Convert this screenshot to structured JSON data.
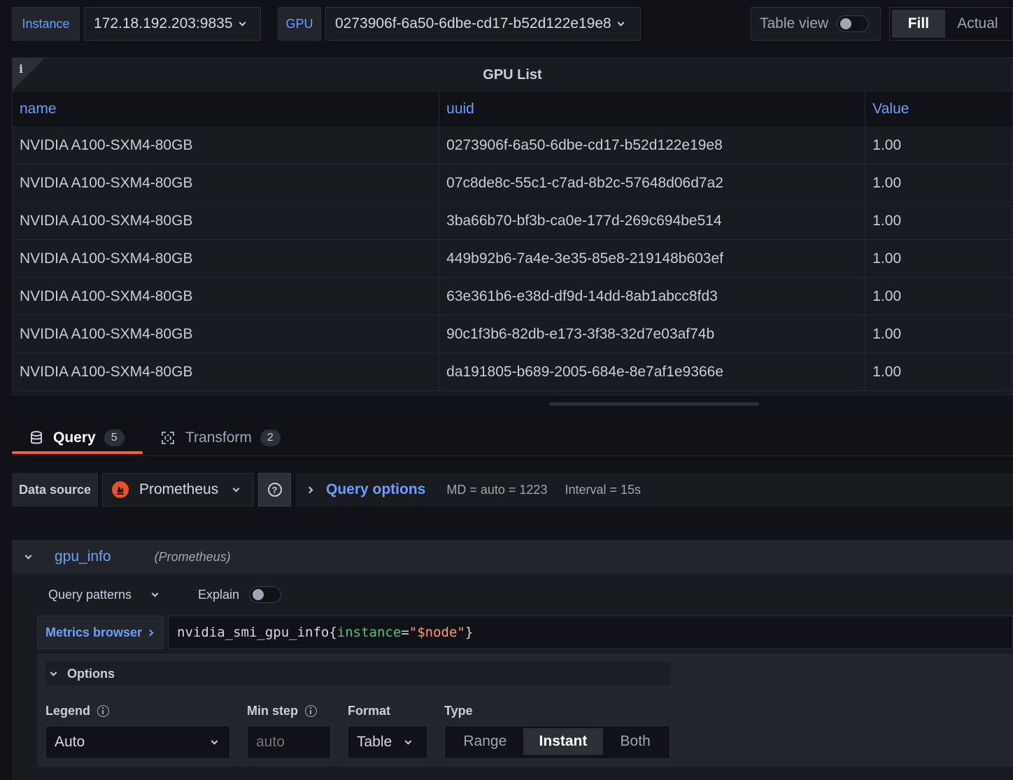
{
  "toolbar": {
    "instance_label": "Instance",
    "instance_value": "172.18.192.203:9835",
    "gpu_label": "GPU",
    "gpu_value": "0273906f-6a50-6dbe-cd17-b52d122e19e8",
    "table_view_label": "Table view",
    "table_view_on": false,
    "fill_label": "Fill",
    "actual_label": "Actual"
  },
  "panel": {
    "info_icon": "i",
    "title": "GPU List",
    "columns": [
      "name",
      "uuid",
      "Value"
    ],
    "rows": [
      [
        "NVIDIA A100-SXM4-80GB",
        "0273906f-6a50-6dbe-cd17-b52d122e19e8",
        "1.00"
      ],
      [
        "NVIDIA A100-SXM4-80GB",
        "07c8de8c-55c1-c7ad-8b2c-57648d06d7a2",
        "1.00"
      ],
      [
        "NVIDIA A100-SXM4-80GB",
        "3ba66b70-bf3b-ca0e-177d-269c694be514",
        "1.00"
      ],
      [
        "NVIDIA A100-SXM4-80GB",
        "449b92b6-7a4e-3e35-85e8-219148b603ef",
        "1.00"
      ],
      [
        "NVIDIA A100-SXM4-80GB",
        "63e361b6-e38d-df9d-14dd-8ab1abcc8fd3",
        "1.00"
      ],
      [
        "NVIDIA A100-SXM4-80GB",
        "90c1f3b6-82db-e173-3f38-32d7e03af74b",
        "1.00"
      ],
      [
        "NVIDIA A100-SXM4-80GB",
        "da191805-b689-2005-684e-8e7af1e9366e",
        "1.00"
      ]
    ]
  },
  "tabs": {
    "query_label": "Query",
    "query_count": "5",
    "transform_label": "Transform",
    "transform_count": "2"
  },
  "query_bar": {
    "datasource_label": "Data source",
    "datasource_value": "Prometheus",
    "help_icon": "?",
    "query_options_label": "Query options",
    "md_text": "MD = auto = 1223",
    "interval_text": "Interval = 15s"
  },
  "query": {
    "name": "gpu_info",
    "datasource_hint": "(Prometheus)",
    "patterns_label": "Query patterns",
    "explain_label": "Explain",
    "explain_on": false,
    "metrics_browser_label": "Metrics browser",
    "expr_metric": "nvidia_smi_gpu_info",
    "expr_open": "{",
    "expr_label": "instance",
    "expr_eq": "=",
    "expr_value": "\"$node\"",
    "expr_close": "}"
  },
  "options": {
    "title": "Options",
    "legend_label": "Legend",
    "legend_value": "Auto",
    "minstep_label": "Min step",
    "minstep_placeholder": "auto",
    "format_label": "Format",
    "format_value": "Table",
    "type_label": "Type",
    "type_options": [
      "Range",
      "Instant",
      "Both"
    ],
    "type_selected": "Instant"
  },
  "colors": {
    "accent_blue": "#6e9fff",
    "tab_underline": "#ff5f2e",
    "prometheus": "#e6522c"
  }
}
